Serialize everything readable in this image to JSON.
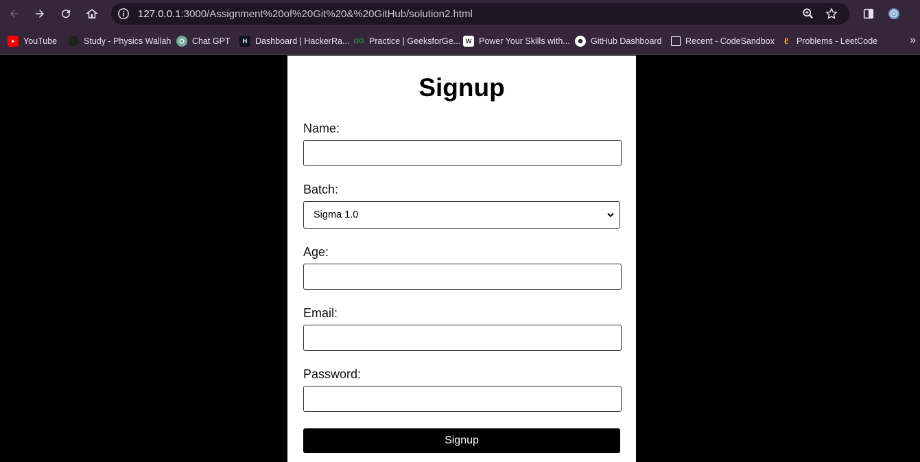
{
  "browser": {
    "url_host": "127.0.0.1",
    "url_path": ":3000/Assignment%20of%20Git%20&%20GitHub/solution2.html",
    "bookmarks": [
      {
        "label": "YouTube",
        "color": "#ff0000"
      },
      {
        "label": "Study - Physics Wallah",
        "color": "#444444"
      },
      {
        "label": "Chat GPT",
        "color": "#74aa9c"
      },
      {
        "label": "Dashboard | HackerRa...",
        "color": "#1ba94c"
      },
      {
        "label": "Practice | GeeksforGe...",
        "color": "#2f8d46"
      },
      {
        "label": "Power Your Skills with...",
        "color": "#ffffff"
      },
      {
        "label": "GitHub Dashboard",
        "color": "#ffffff"
      },
      {
        "label": "Recent - CodeSandbox",
        "color": "#ffffff"
      },
      {
        "label": "Problems - LeetCode",
        "color": "#ffa116"
      }
    ]
  },
  "form": {
    "title": "Signup",
    "name_label": "Name:",
    "batch_label": "Batch:",
    "batch_selected": "Sigma 1.0",
    "age_label": "Age:",
    "email_label": "Email:",
    "password_label": "Password:",
    "submit_label": "Signup"
  }
}
